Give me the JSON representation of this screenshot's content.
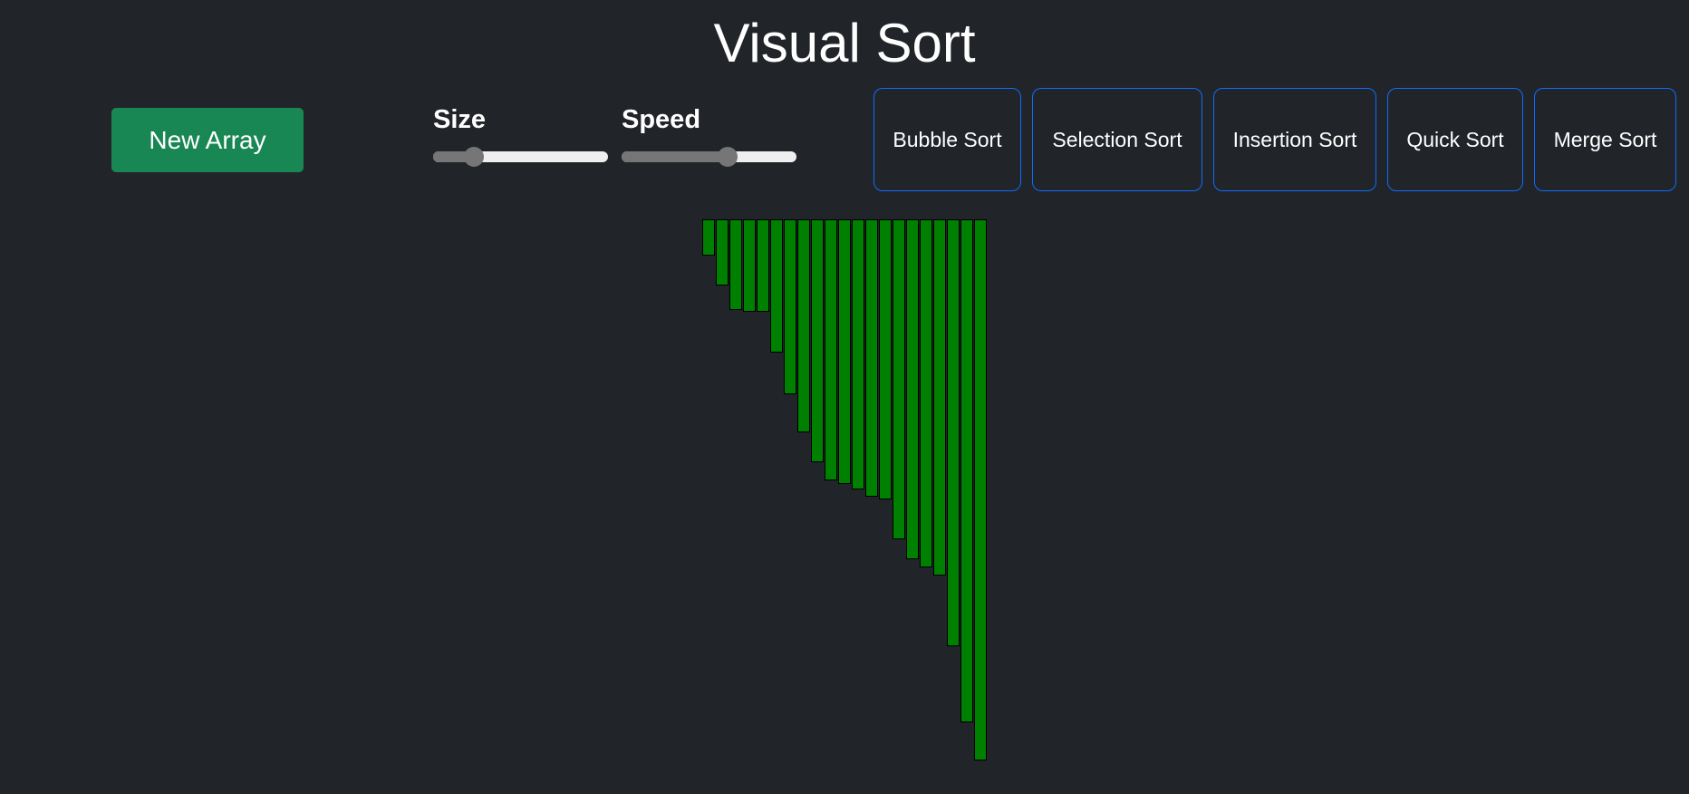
{
  "app": {
    "title": "Visual Sort"
  },
  "controls": {
    "new_array_label": "New Array",
    "size": {
      "label": "Size",
      "value": 0.2
    },
    "speed": {
      "label": "Speed",
      "value": 0.62
    }
  },
  "algorithms": [
    {
      "label": "Bubble Sort"
    },
    {
      "label": "Selection Sort"
    },
    {
      "label": "Insertion Sort"
    },
    {
      "label": "Quick Sort"
    },
    {
      "label": "Merge Sort"
    }
  ],
  "colors": {
    "background": "#212429",
    "bar": "#008000",
    "primary_button": "#198754",
    "outline_button": "#0d6efd"
  },
  "array": {
    "values": [
      40,
      73,
      100,
      102,
      102,
      147,
      193,
      235,
      268,
      288,
      292,
      298,
      306,
      309,
      353,
      375,
      384,
      393,
      471,
      555,
      597
    ]
  }
}
